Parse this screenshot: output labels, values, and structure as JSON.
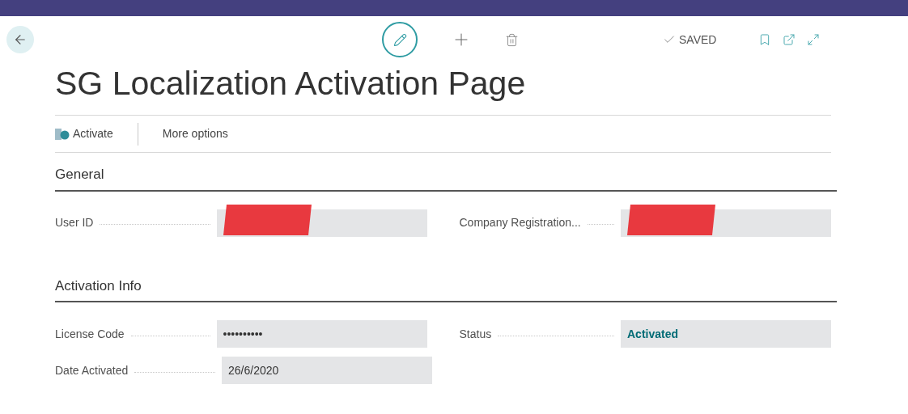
{
  "page": {
    "title": "SG Localization Activation Page",
    "save_status": "SAVED"
  },
  "actions": [
    {
      "label": "Activate",
      "kind": "icon"
    },
    {
      "label": "More options",
      "kind": "plain"
    }
  ],
  "sections": [
    {
      "title": "General",
      "rows": [
        [
          {
            "label": "User ID",
            "redacted": true
          },
          {
            "label": "Company Registration...",
            "redacted": true
          }
        ]
      ]
    },
    {
      "title": "Activation Info",
      "rows": [
        [
          {
            "label": "License Code",
            "value": "••••••••••",
            "redacted": false,
            "emphasis": false
          },
          {
            "label": "Status",
            "value": "Activated",
            "redacted": false,
            "emphasis": true
          }
        ],
        [
          {
            "label": "Date Activated",
            "value": "26/6/2020",
            "redacted": false,
            "emphasis": false
          }
        ]
      ]
    }
  ]
}
